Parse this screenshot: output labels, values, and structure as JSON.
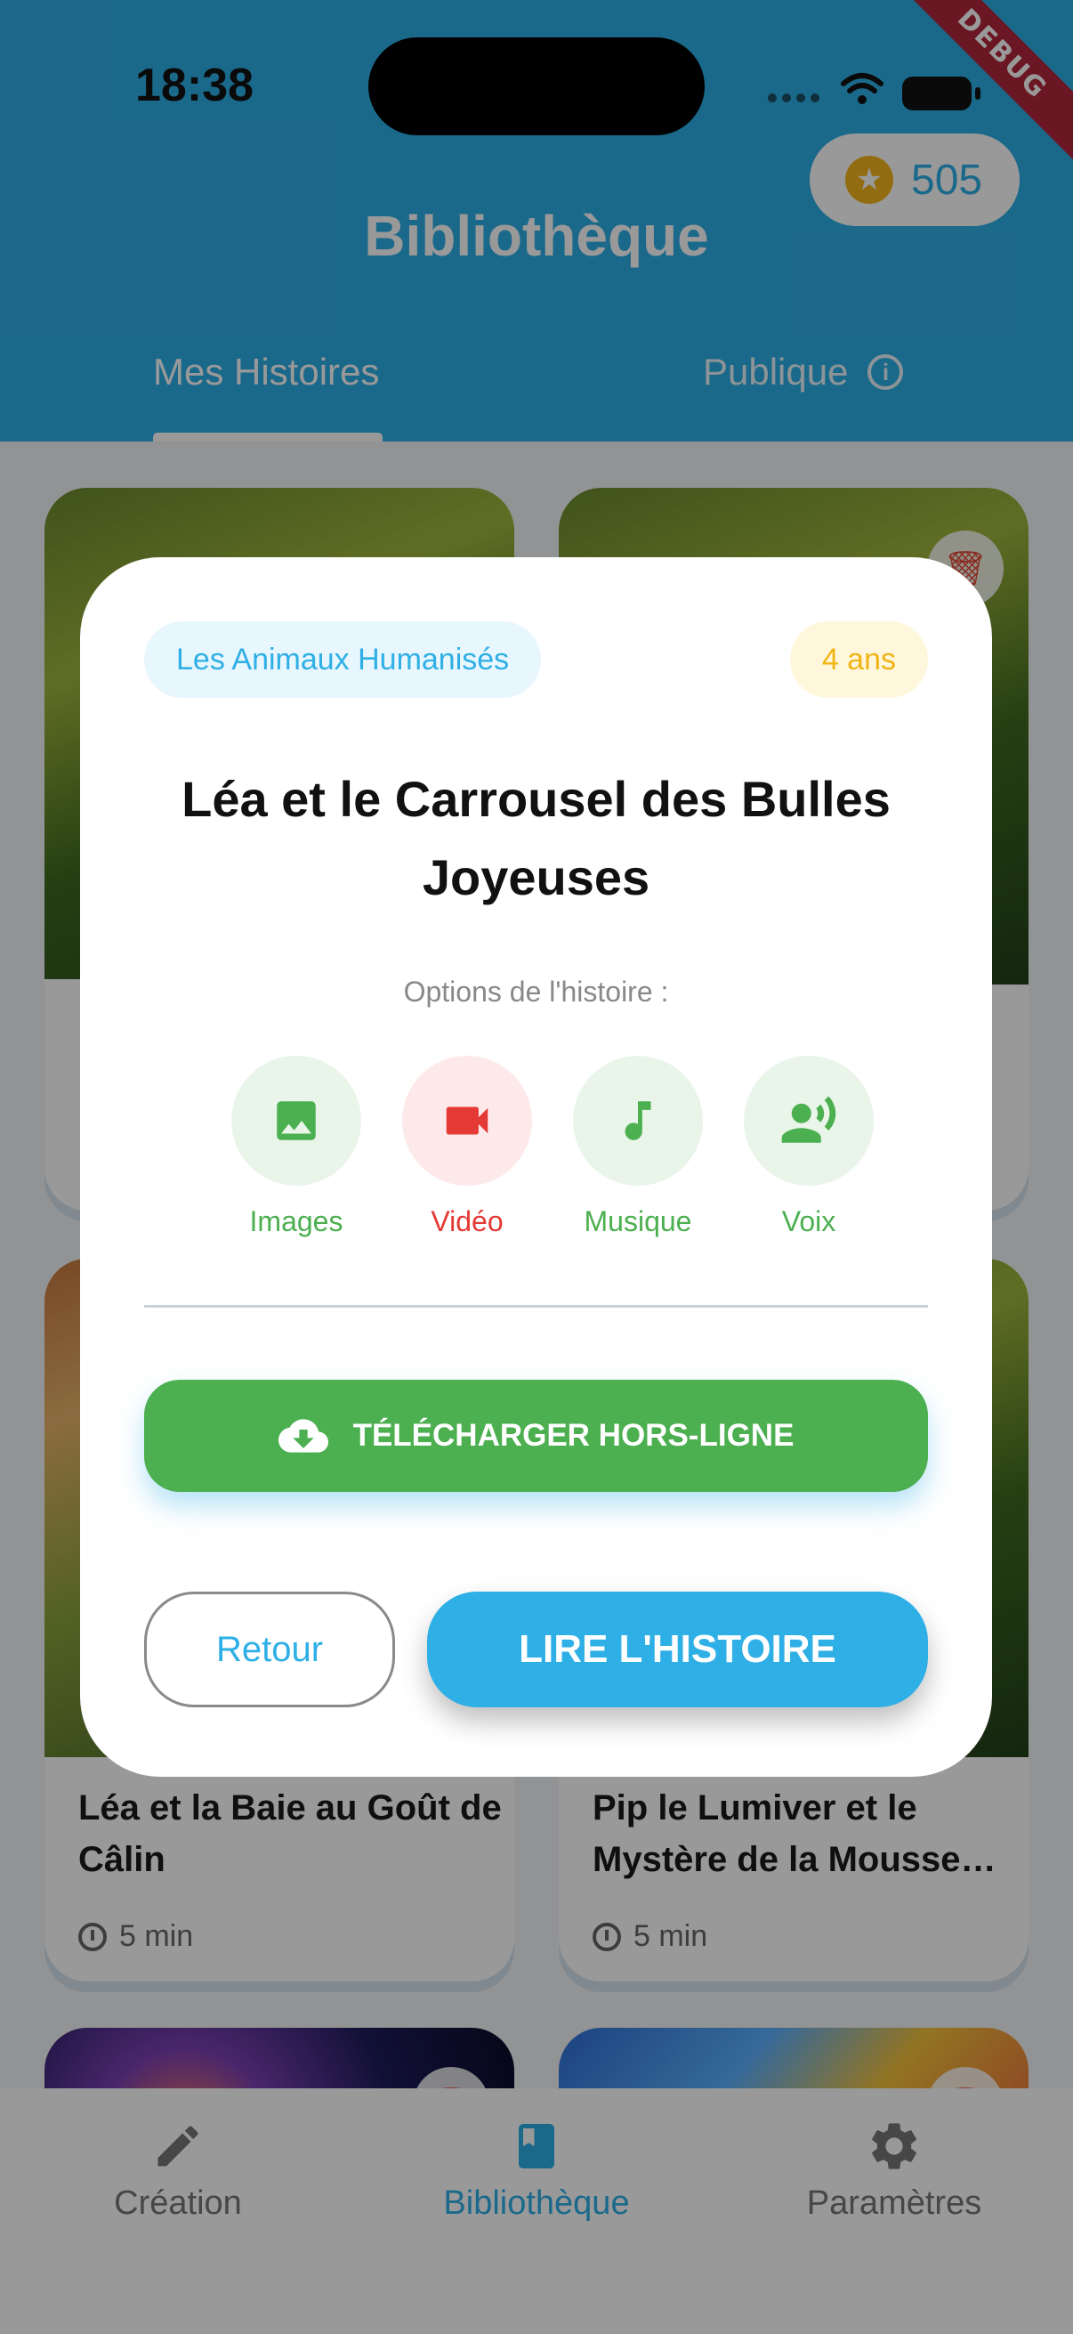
{
  "status_bar": {
    "time": "18:38",
    "debug_label": "DEBUG"
  },
  "header": {
    "coins": "505",
    "title": "Bibliothèque",
    "tabs": [
      {
        "label": "Mes Histoires",
        "active": true
      },
      {
        "label": "Publique",
        "info_icon": "info-icon"
      }
    ]
  },
  "stories": [
    {
      "title": "Léa et la Baie au Goût de Câlin",
      "duration": "5 min"
    },
    {
      "title": "Pip le Lumiver et le Mystère de la Mousse…",
      "duration": "5 min"
    }
  ],
  "bottom_nav": [
    {
      "label": "Création",
      "icon": "pencil-icon"
    },
    {
      "label": "Bibliothèque",
      "icon": "book-icon",
      "active": true
    },
    {
      "label": "Paramètres",
      "icon": "gear-icon"
    }
  ],
  "dialog": {
    "category": "Les Animaux Humanisés",
    "age": "4 ans",
    "title": "Léa et le Carrousel des Bulles Joyeuses",
    "options_label": "Options de l'histoire :",
    "options": [
      {
        "label": "Images",
        "icon": "image-icon",
        "color": "#4caf50"
      },
      {
        "label": "Vidéo",
        "icon": "video-camera-icon",
        "color": "#e53935"
      },
      {
        "label": "Musique",
        "icon": "music-note-icon",
        "color": "#4caf50"
      },
      {
        "label": "Voix",
        "icon": "voice-icon",
        "color": "#4caf50"
      }
    ],
    "download_label": "TÉLÉCHARGER HORS-LIGNE",
    "back_label": "Retour",
    "read_label": "LIRE L'HISTOIRE"
  },
  "colors": {
    "primary": "#2eafe6",
    "green": "#4caf50",
    "red": "#e53935",
    "gold": "#f3b51b"
  }
}
